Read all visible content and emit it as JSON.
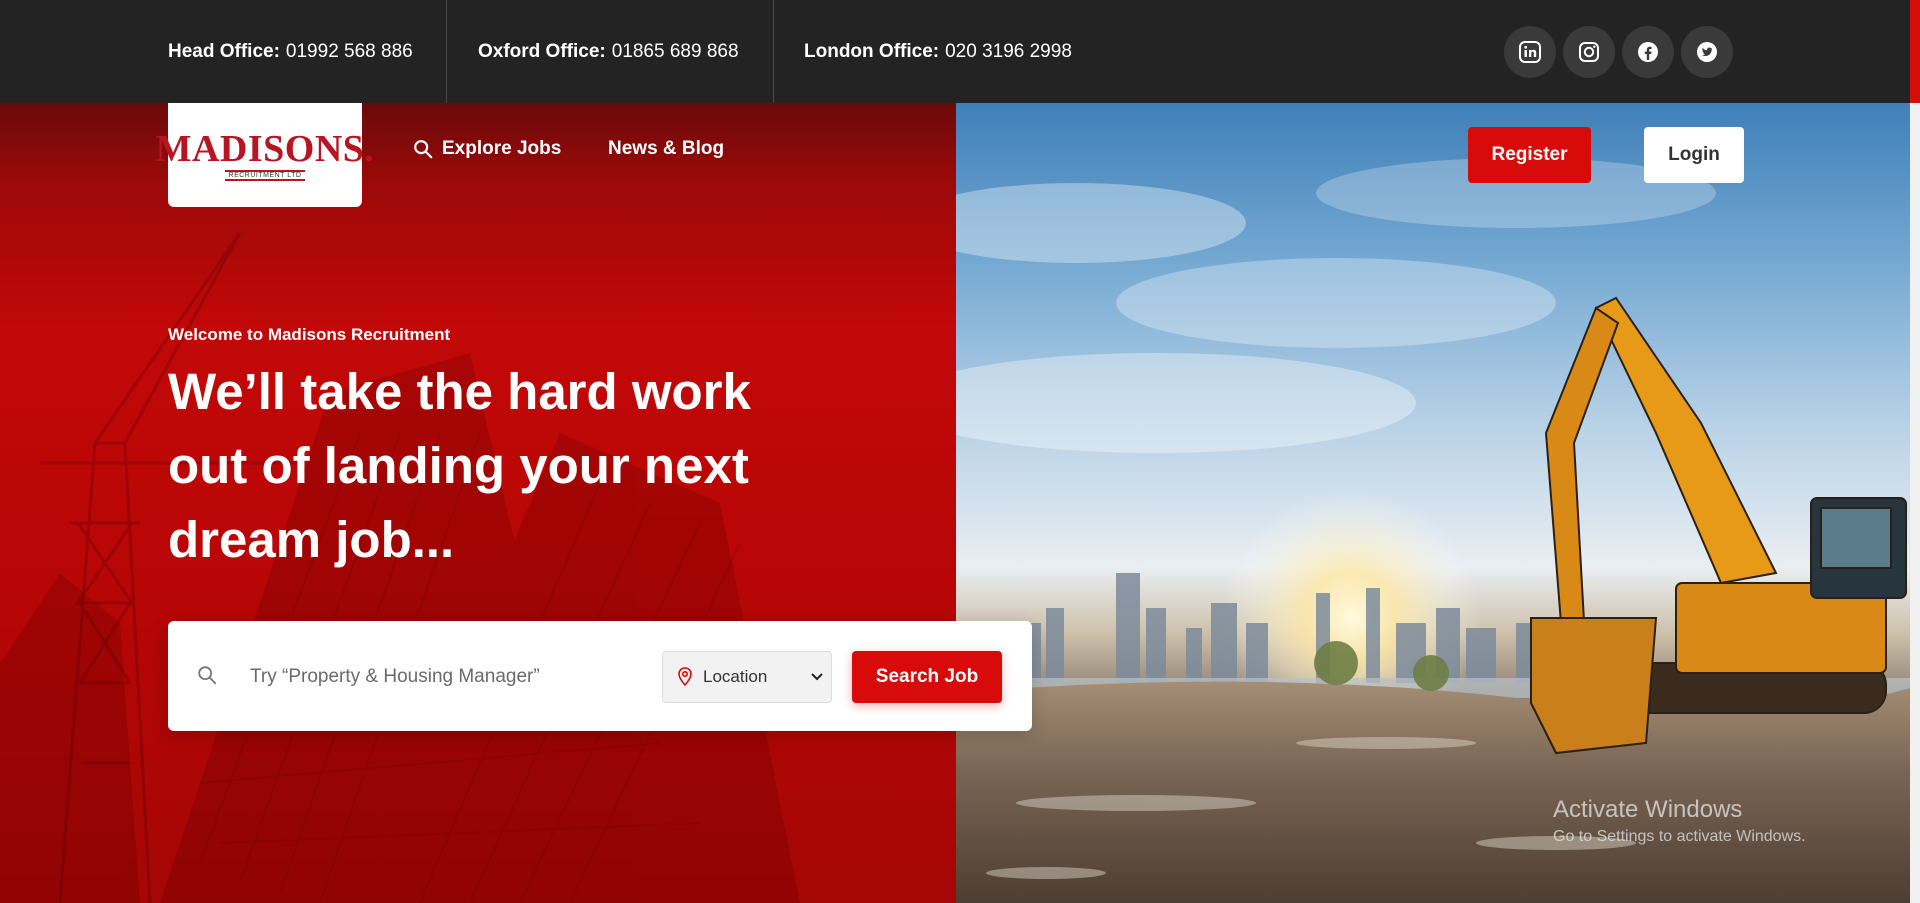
{
  "topbar": {
    "offices": [
      {
        "label": "Head Office:",
        "phone": "01992 568 886"
      },
      {
        "label": "Oxford Office:",
        "phone": "01865 689 868"
      },
      {
        "label": "London Office:",
        "phone": "020 3196 2998"
      }
    ],
    "social": [
      "linkedin-icon",
      "instagram-icon",
      "facebook-icon",
      "twitter-icon"
    ]
  },
  "brand": {
    "name": "MADISONS.",
    "sub": "RECRUITMENT LTD"
  },
  "nav": {
    "explore": "Explore Jobs",
    "blog": "News & Blog"
  },
  "auth": {
    "register": "Register",
    "login": "Login"
  },
  "hero": {
    "eyebrow": "Welcome to Madisons Recruitment",
    "headline": "We’ll take the hard work out of landing your next dream job..."
  },
  "search": {
    "placeholder": "Try “Property & Housing Manager”",
    "location": "Location",
    "button": "Search Job"
  },
  "watermark": {
    "title": "Activate Windows",
    "sub": "Go to Settings to activate Windows."
  },
  "colors": {
    "brand_red": "#d90a0a",
    "topbar": "#232323"
  }
}
